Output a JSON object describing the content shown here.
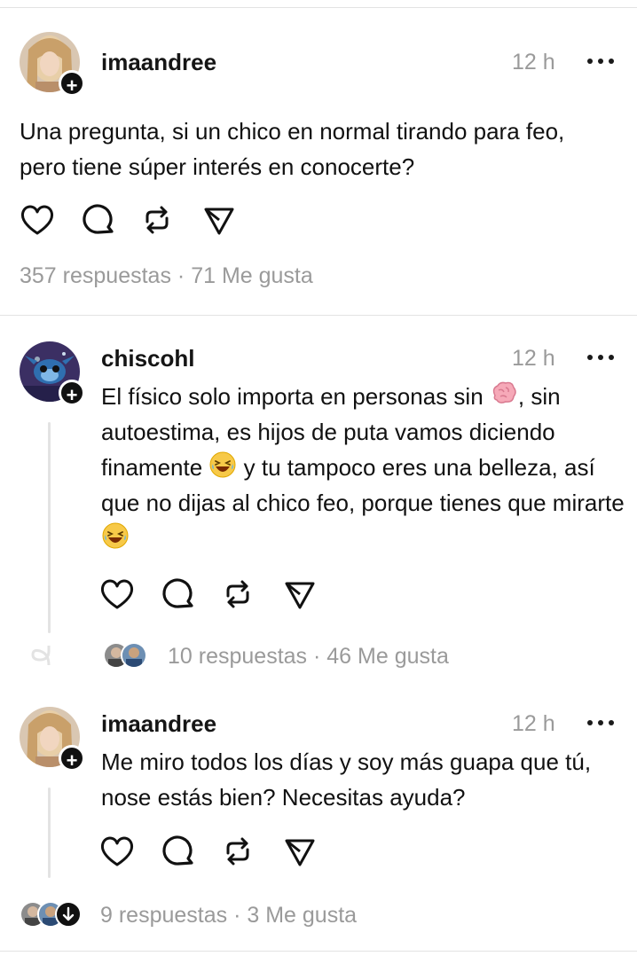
{
  "post": {
    "username": "imaandree",
    "time": "12 h",
    "text": "Una pregunta, si un chico en normal tirando para feo, pero tiene súper interés en conocerte?",
    "replies": "357 respuestas",
    "separator": "·",
    "likes": "71 Me gusta"
  },
  "replies": [
    {
      "username": "chiscohl",
      "time": "12 h",
      "text_part1": "El físico solo importa en personas sin",
      "text_part2": ", sin autoestima, es hijos de puta vamos diciendo finamente",
      "text_part3": "y tu tampoco eres una belleza, así que no dijas al chico feo, porque tienes que mirarte",
      "replies": "10 respuestas",
      "separator": "·",
      "likes": "46 Me gusta",
      "emojis": [
        "brain-emoji",
        "laughing-emoji",
        "laughing-emoji"
      ]
    },
    {
      "username": "imaandree",
      "time": "12 h",
      "text": "Me miro todos los días y soy más guapa que tú, nose estás bien? Necesitas ayuda?",
      "replies": "9 respuestas",
      "separator": "·",
      "likes": "3 Me gusta"
    }
  ],
  "icons": [
    "heart-icon",
    "comment-icon",
    "repost-icon",
    "share-icon",
    "more-icon",
    "follow-plus-icon"
  ],
  "colors": {
    "text": "#111111",
    "muted": "#9a9a9a",
    "divider": "#e3e3e3"
  }
}
